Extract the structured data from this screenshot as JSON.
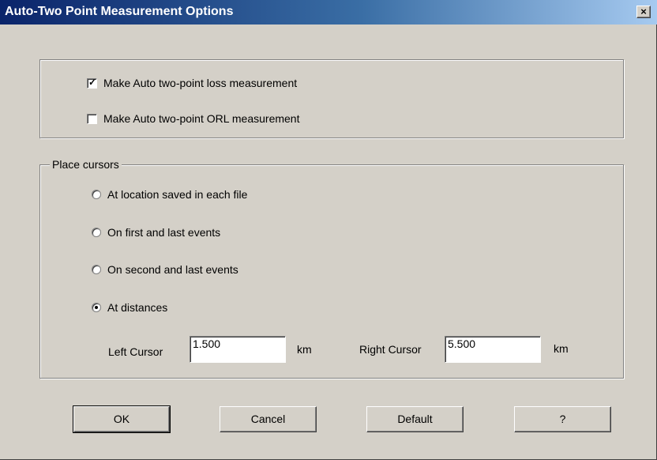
{
  "window": {
    "title": "Auto-Two Point Measurement Options",
    "close_label": "×"
  },
  "measurements": {
    "loss": {
      "label": "Make Auto two-point loss measurement",
      "checked": true
    },
    "orl": {
      "label": "Make Auto two-point ORL measurement",
      "checked": false
    }
  },
  "place_cursors": {
    "legend": "Place cursors",
    "options": [
      {
        "label": "At location saved in each file",
        "selected": false
      },
      {
        "label": "On first and last events",
        "selected": false
      },
      {
        "label": "On second and last events",
        "selected": false
      },
      {
        "label": "At distances",
        "selected": true
      }
    ],
    "left_cursor": {
      "label": "Left Cursor",
      "value": "1.500",
      "unit": "km"
    },
    "right_cursor": {
      "label": "Right Cursor",
      "value": "5.500",
      "unit": "km"
    }
  },
  "buttons": {
    "ok": "OK",
    "cancel": "Cancel",
    "default": "Default",
    "help": "?"
  },
  "colors": {
    "face": "#d4d0c8",
    "title_start": "#0a246a",
    "title_end": "#a6caf0"
  }
}
